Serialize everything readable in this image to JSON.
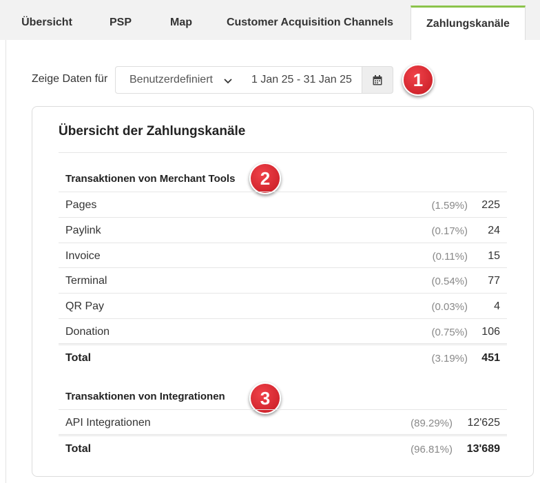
{
  "tabs": [
    {
      "label": "Übersicht",
      "active": false
    },
    {
      "label": "PSP",
      "active": false
    },
    {
      "label": "Map",
      "active": false
    },
    {
      "label": "Customer Acquisition Channels",
      "active": false
    },
    {
      "label": "Zahlungskanäle",
      "active": true
    }
  ],
  "filter": {
    "label": "Zeige Daten für",
    "range_select": "Benutzerdefiniert",
    "date_range": "1 Jan 25 - 31 Jan 25"
  },
  "badges": [
    "1",
    "2",
    "3"
  ],
  "card": {
    "title": "Übersicht der Zahlungskanäle",
    "merchant_tools": {
      "heading": "Transaktionen von Merchant Tools",
      "rows": [
        {
          "label": "Pages",
          "pct": "(1.59%)",
          "value": "225"
        },
        {
          "label": "Paylink",
          "pct": "(0.17%)",
          "value": "24"
        },
        {
          "label": "Invoice",
          "pct": "(0.11%)",
          "value": "15"
        },
        {
          "label": "Terminal",
          "pct": "(0.54%)",
          "value": "77"
        },
        {
          "label": "QR Pay",
          "pct": "(0.03%)",
          "value": "4"
        },
        {
          "label": "Donation",
          "pct": "(0.75%)",
          "value": "106"
        }
      ],
      "total": {
        "label": "Total",
        "pct": "(3.19%)",
        "value": "451"
      }
    },
    "integrations": {
      "heading": "Transaktionen von Integrationen",
      "rows": [
        {
          "label": "API Integrationen",
          "pct": "(89.29%)",
          "value": "12'625"
        }
      ],
      "total": {
        "label": "Total",
        "pct": "(96.81%)",
        "value": "13'689"
      }
    }
  },
  "colors": {
    "accent": "#8bc34a",
    "badge": "#d9252d"
  }
}
